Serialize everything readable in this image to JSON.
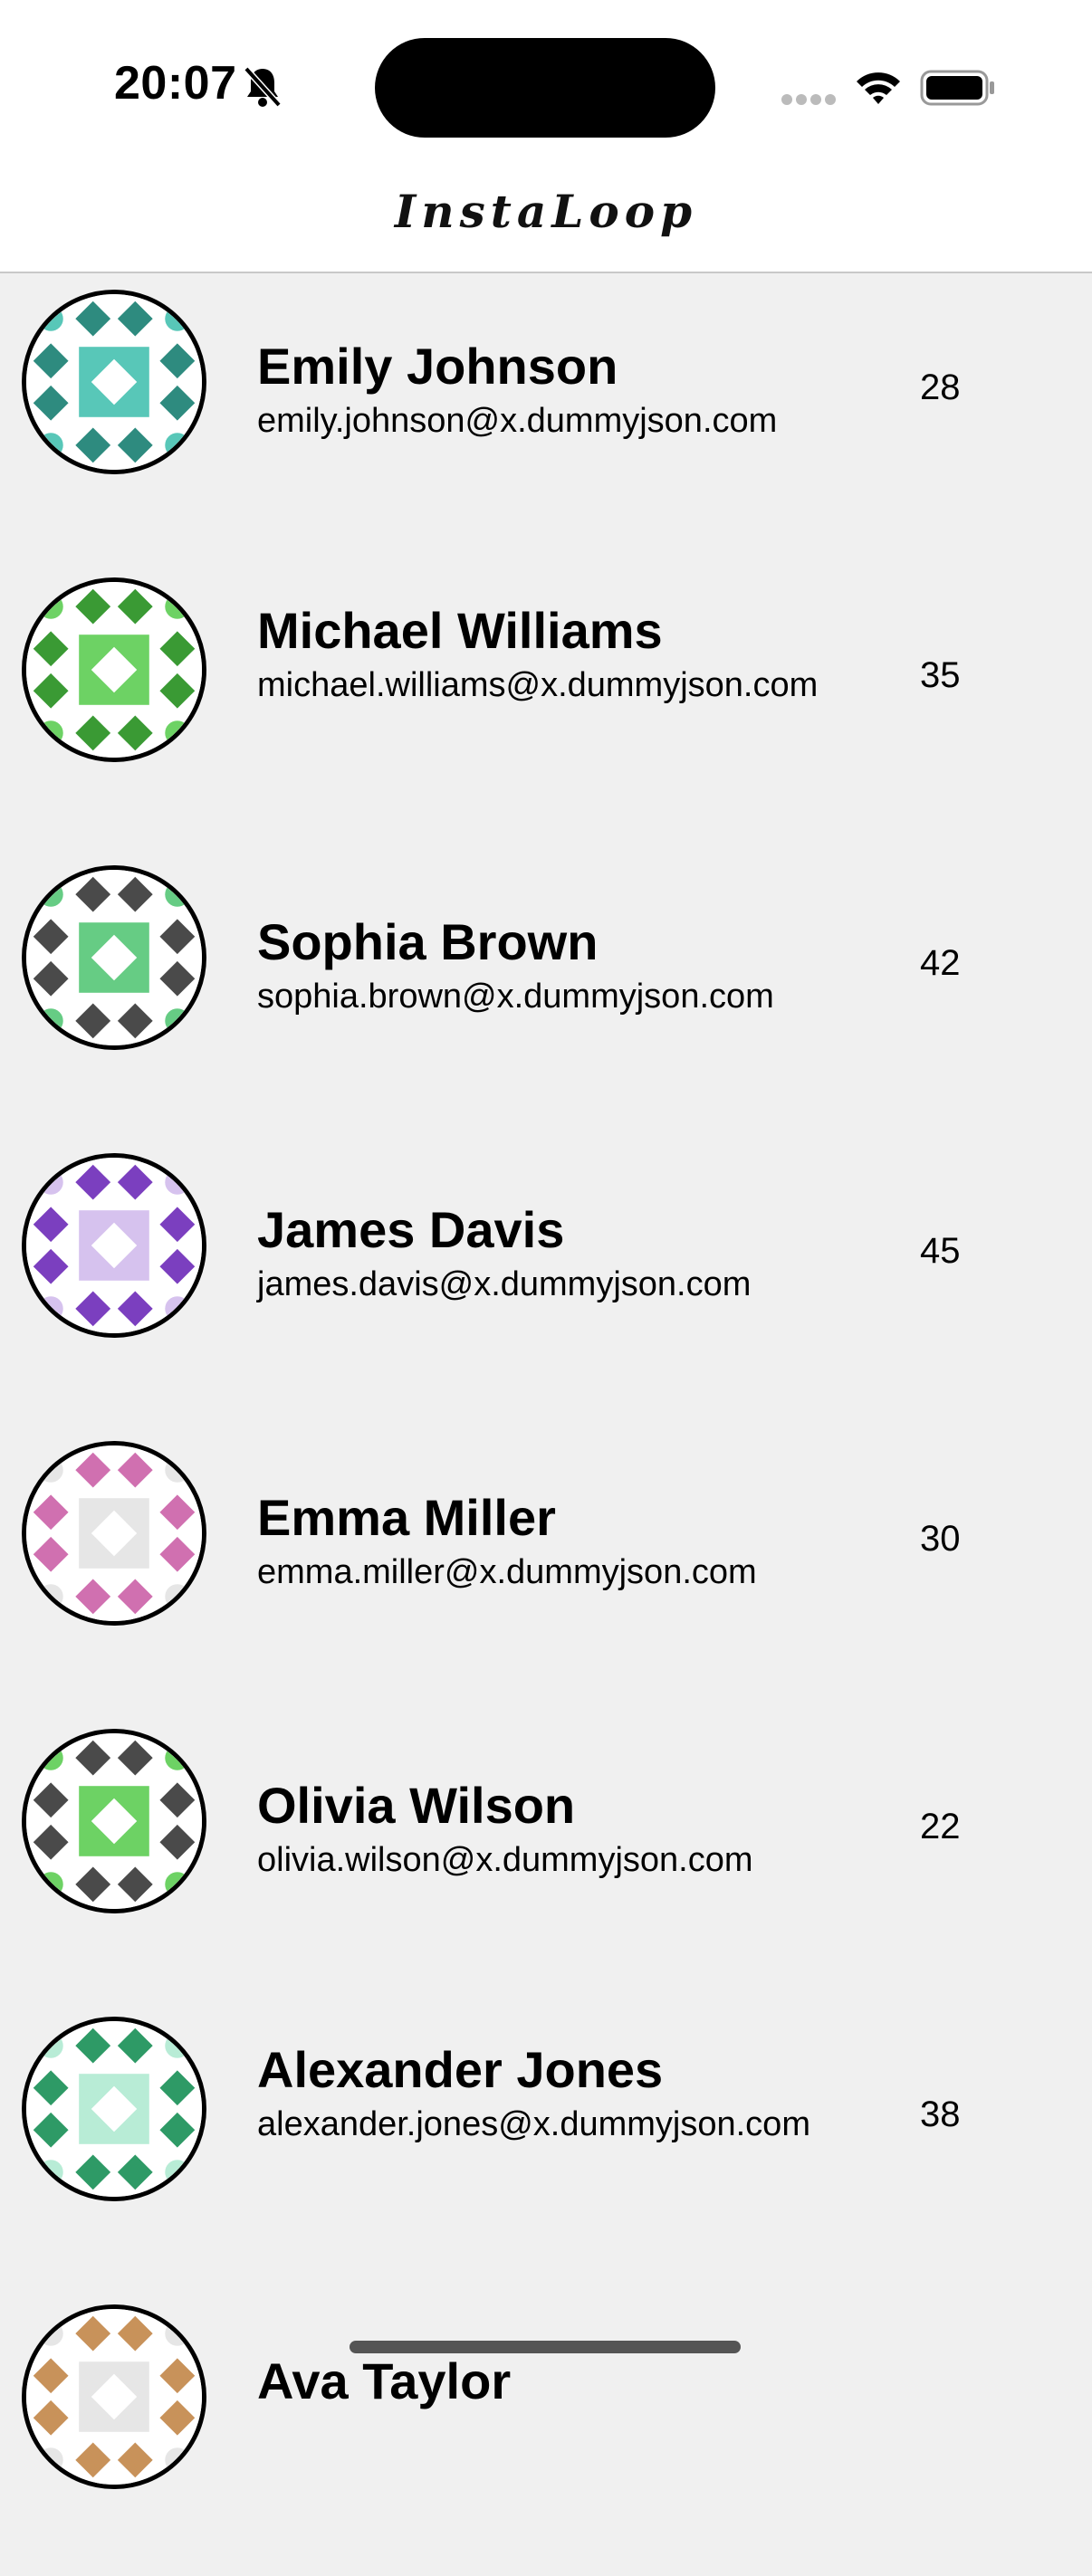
{
  "status_bar": {
    "time": "20:07",
    "icons": [
      "bell-slash-icon",
      "cellular-signal-icon",
      "wifi-icon",
      "battery-icon"
    ]
  },
  "header": {
    "title": "InstaLoop"
  },
  "users": [
    {
      "name": "Emily Johnson",
      "email": "emily.johnson@x.dummyjson.com",
      "age": "28",
      "avatar_color": "#2e8b7f",
      "avatar_accent": "#58c7b8"
    },
    {
      "name": "Michael Williams",
      "email": "michael.williams@x.dummyjson.com",
      "age": "35",
      "avatar_color": "#3a9a34",
      "avatar_accent": "#6dd264"
    },
    {
      "name": "Sophia Brown",
      "email": "sophia.brown@x.dummyjson.com",
      "age": "42",
      "avatar_color": "#4a4a4a",
      "avatar_accent": "#66cc84"
    },
    {
      "name": "James Davis",
      "email": "james.davis@x.dummyjson.com",
      "age": "45",
      "avatar_color": "#7b3fbf",
      "avatar_accent": "#d6c2ee"
    },
    {
      "name": "Emma Miller",
      "email": "emma.miller@x.dummyjson.com",
      "age": "30",
      "avatar_color": "#d070b0",
      "avatar_accent": "#e6e6e6"
    },
    {
      "name": "Olivia Wilson",
      "email": "olivia.wilson@x.dummyjson.com",
      "age": "22",
      "avatar_color": "#4a4a4a",
      "avatar_accent": "#6dd264"
    },
    {
      "name": "Alexander Jones",
      "email": "alexander.jones@x.dummyjson.com",
      "age": "38",
      "avatar_color": "#2e9a66",
      "avatar_accent": "#b8ecd6"
    },
    {
      "name": "Ava Taylor",
      "email": "",
      "age": "",
      "avatar_color": "#c8925a",
      "avatar_accent": "#e6e6e6"
    }
  ]
}
